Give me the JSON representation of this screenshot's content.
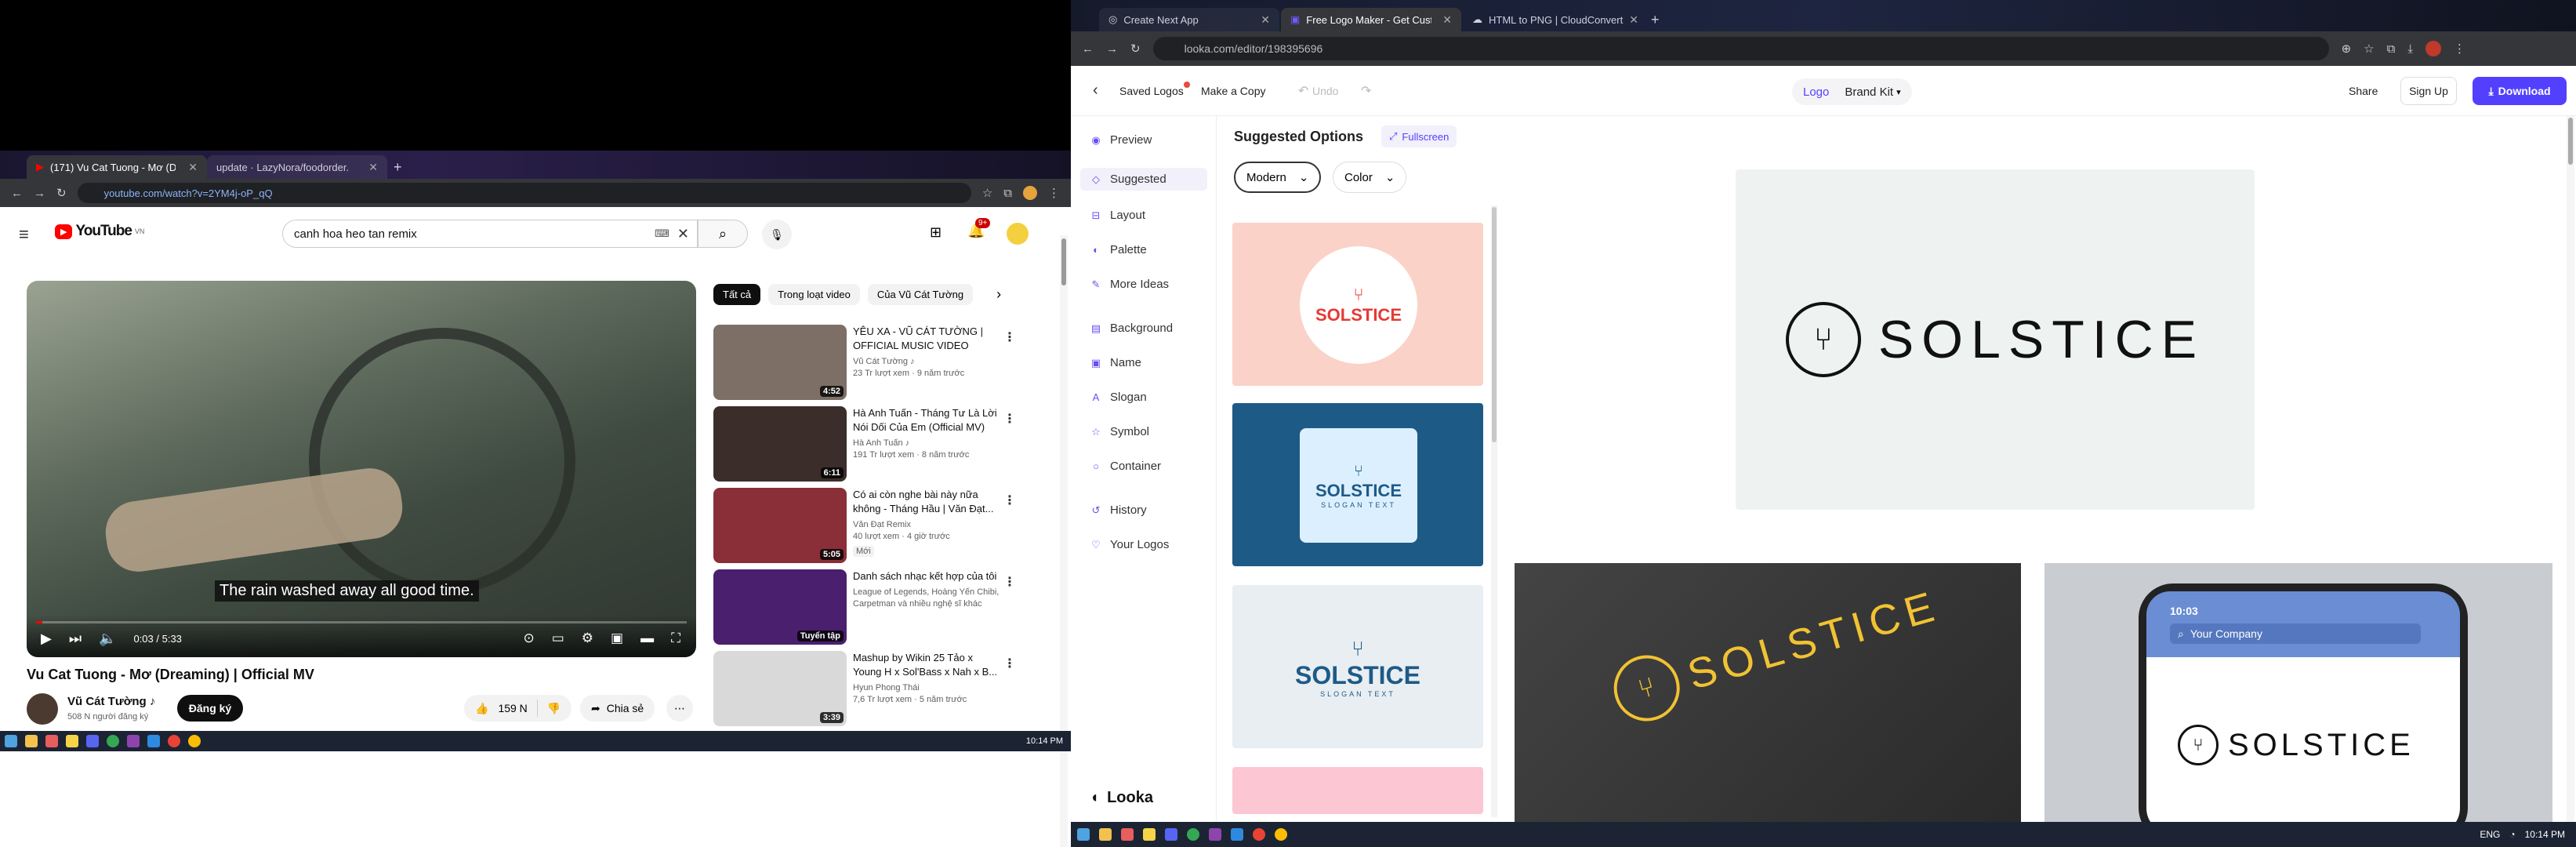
{
  "left_browser": {
    "tabs": [
      {
        "label": "(171) Vu Cat Tuong - Mơ (Dre..."
      },
      {
        "label": "update · LazyNora/foodorder..."
      }
    ],
    "url": "youtube.com/watch?v=2YM4j-oP_qQ",
    "youtube": {
      "logo_text": "YouTube",
      "logo_sup": "VN",
      "search_value": "canh hoa heo tan remix",
      "notif_badge": "9+",
      "caption": "The rain washed away all good time.",
      "time": "0:03 / 5:33",
      "video_title": "Vu Cat Tuong - Mơ (Dreaming) | Official MV",
      "channel": "Vũ Cát Tường ♪",
      "subscribers": "508 N người đăng ký",
      "subscribe_label": "Đăng ký",
      "likes": "159 N",
      "share_label": "Chia sẻ",
      "chips": [
        "Tất cả",
        "Trong loạt video",
        "Của Vũ Cát Tường"
      ],
      "related": [
        {
          "title": "YÊU XA - VŨ CÁT TƯỜNG | OFFICIAL MUSIC VIDEO",
          "channel": "Vũ Cát Tường ♪",
          "meta": "23 Tr lượt xem · 9 năm trước",
          "duration": "4:52",
          "color": "#7d6f66"
        },
        {
          "title": "Hà Anh Tuấn - Tháng Tư Là Lời Nói Dối Của Em (Official MV)",
          "channel": "Hà Anh Tuấn ♪",
          "meta": "191 Tr lượt xem · 8 năm trước",
          "duration": "6:11",
          "color": "#3b2e2a"
        },
        {
          "title": "Có ai còn nghe bài này nữa không - Tháng Hầu | Văn Đạt...",
          "channel": "Văn Đạt Remix",
          "meta": "40 lượt xem · 4 giờ trước",
          "badge": "Mới",
          "duration": "5:05",
          "color": "#8a2f38"
        },
        {
          "title": "Danh sách nhạc kết hợp của tôi",
          "channel": "League of Legends, Hoàng Yến Chibi, Carpetman và nhiều nghệ sĩ khác",
          "meta": "",
          "duration": "Tuyển tập",
          "color": "#4a1f6e"
        },
        {
          "title": "Mashup by Wikin 25 Tảo x Young H x Sol'Bass x Nah x B...",
          "channel": "Hyun Phong Thái",
          "meta": "7,6 Tr lượt xem · 5 năm trước",
          "duration": "3:39",
          "color": "#d9d9d9"
        }
      ]
    },
    "clock": "10:14 PM"
  },
  "right_browser": {
    "tabs": [
      {
        "label": "Create Next App"
      },
      {
        "label": "Free Logo Maker - Get Custom..."
      },
      {
        "label": "HTML to PNG | CloudConvert"
      }
    ],
    "url": "looka.com/editor/198395696",
    "looka": {
      "saved_logos": "Saved Logos",
      "make_copy": "Make a Copy",
      "undo": "Undo",
      "tab_logo": "Logo",
      "tab_brand": "Brand Kit",
      "share": "Share",
      "signup": "Sign Up",
      "download": "Download",
      "nav": [
        "Preview",
        "Suggested",
        "Layout",
        "Palette",
        "More Ideas",
        "Background",
        "Name",
        "Slogan",
        "Symbol",
        "Container",
        "History",
        "Your Logos"
      ],
      "looka_brand": "Looka",
      "options_title": "Suggested Options",
      "fullscreen": "Fullscreen",
      "filter_style": "Modern",
      "filter_color": "Color",
      "brand_name": "SOLSTICE",
      "slogan": "SLOGAN TEXT",
      "mock_search": "Your Company",
      "mock_time": "10:03"
    },
    "clock": "10:14 PM",
    "lang": "ENG",
    "colors": {
      "accent": "#5340ff",
      "card1": "#fbd2c8",
      "card2": "#1e5a86",
      "card3": "#e8eef2"
    }
  }
}
